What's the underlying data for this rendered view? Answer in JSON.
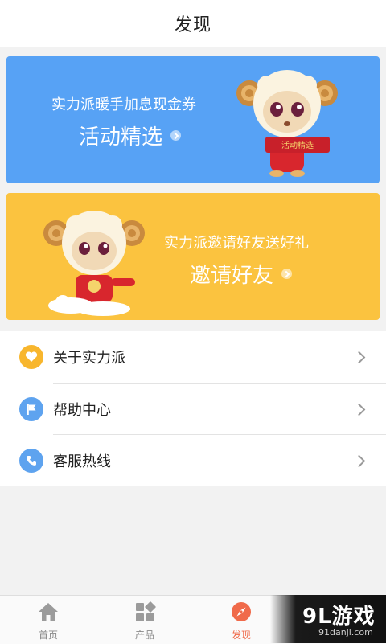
{
  "header": {
    "title": "发现"
  },
  "banners": [
    {
      "subtitle": "实力派暖手加息现金券",
      "title": "活动精选",
      "color": "#57a2f5",
      "scroll_text": "活动精选"
    },
    {
      "subtitle": "实力派邀请好友送好礼",
      "title": "邀请好友",
      "color": "#fbc33f"
    }
  ],
  "menu": {
    "items": [
      {
        "label": "关于实力派",
        "icon": "heart-icon",
        "icon_color": "#f8b62d"
      },
      {
        "label": "帮助中心",
        "icon": "flag-icon",
        "icon_color": "#5ea3ef"
      },
      {
        "label": "客服热线",
        "icon": "phone-icon",
        "icon_color": "#5ea3ef"
      }
    ]
  },
  "tabbar": {
    "tabs": [
      {
        "label": "首页",
        "icon": "home-icon",
        "active": false
      },
      {
        "label": "产品",
        "icon": "grid-icon",
        "active": false
      },
      {
        "label": "发现",
        "icon": "compass-icon",
        "active": true
      }
    ],
    "active_color": "#f06a4a"
  },
  "watermark": {
    "main": "9L游戏",
    "sub": "91danji.com"
  }
}
